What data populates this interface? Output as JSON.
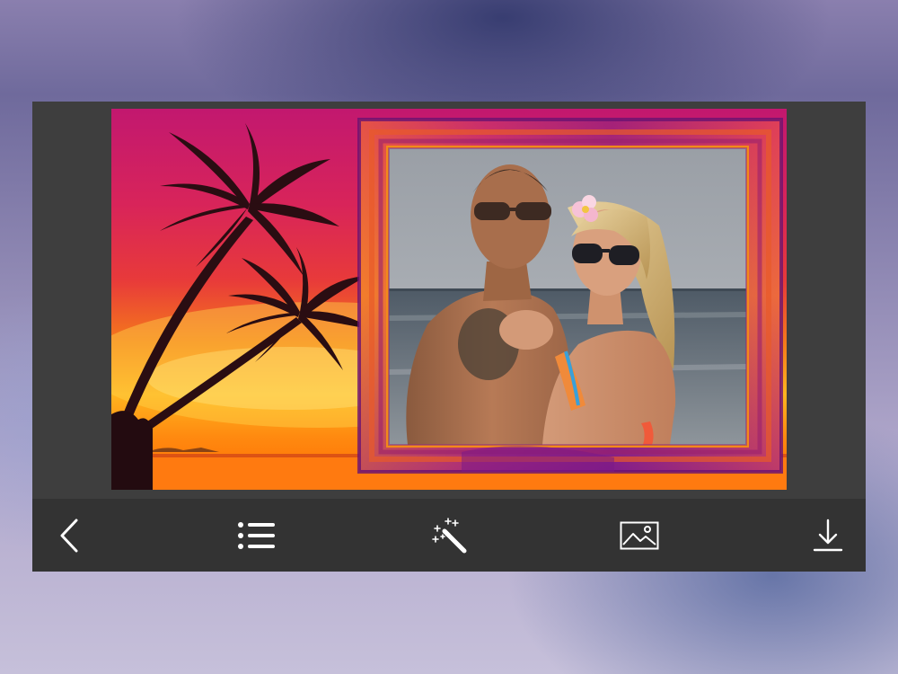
{
  "app": {
    "background_color": "#3e3e3e",
    "toolbar_color": "#333333",
    "icon_color": "#ffffff"
  },
  "canvas": {
    "frame_theme": "tropical-sunset-palm",
    "sunset_colors": [
      "#c2186f",
      "#e83a3a",
      "#f57c1a",
      "#ffb41f",
      "#ff6a00"
    ],
    "frame_colors": [
      "#7b1a86",
      "#c0306e",
      "#f2742a"
    ],
    "photo_subject": "couple-on-beach"
  },
  "toolbar": {
    "items": [
      {
        "id": "back",
        "icon": "chevron-left-icon"
      },
      {
        "id": "frames",
        "icon": "list-icon"
      },
      {
        "id": "effects",
        "icon": "magic-wand-icon"
      },
      {
        "id": "gallery",
        "icon": "image-icon"
      },
      {
        "id": "save",
        "icon": "download-icon"
      }
    ]
  }
}
